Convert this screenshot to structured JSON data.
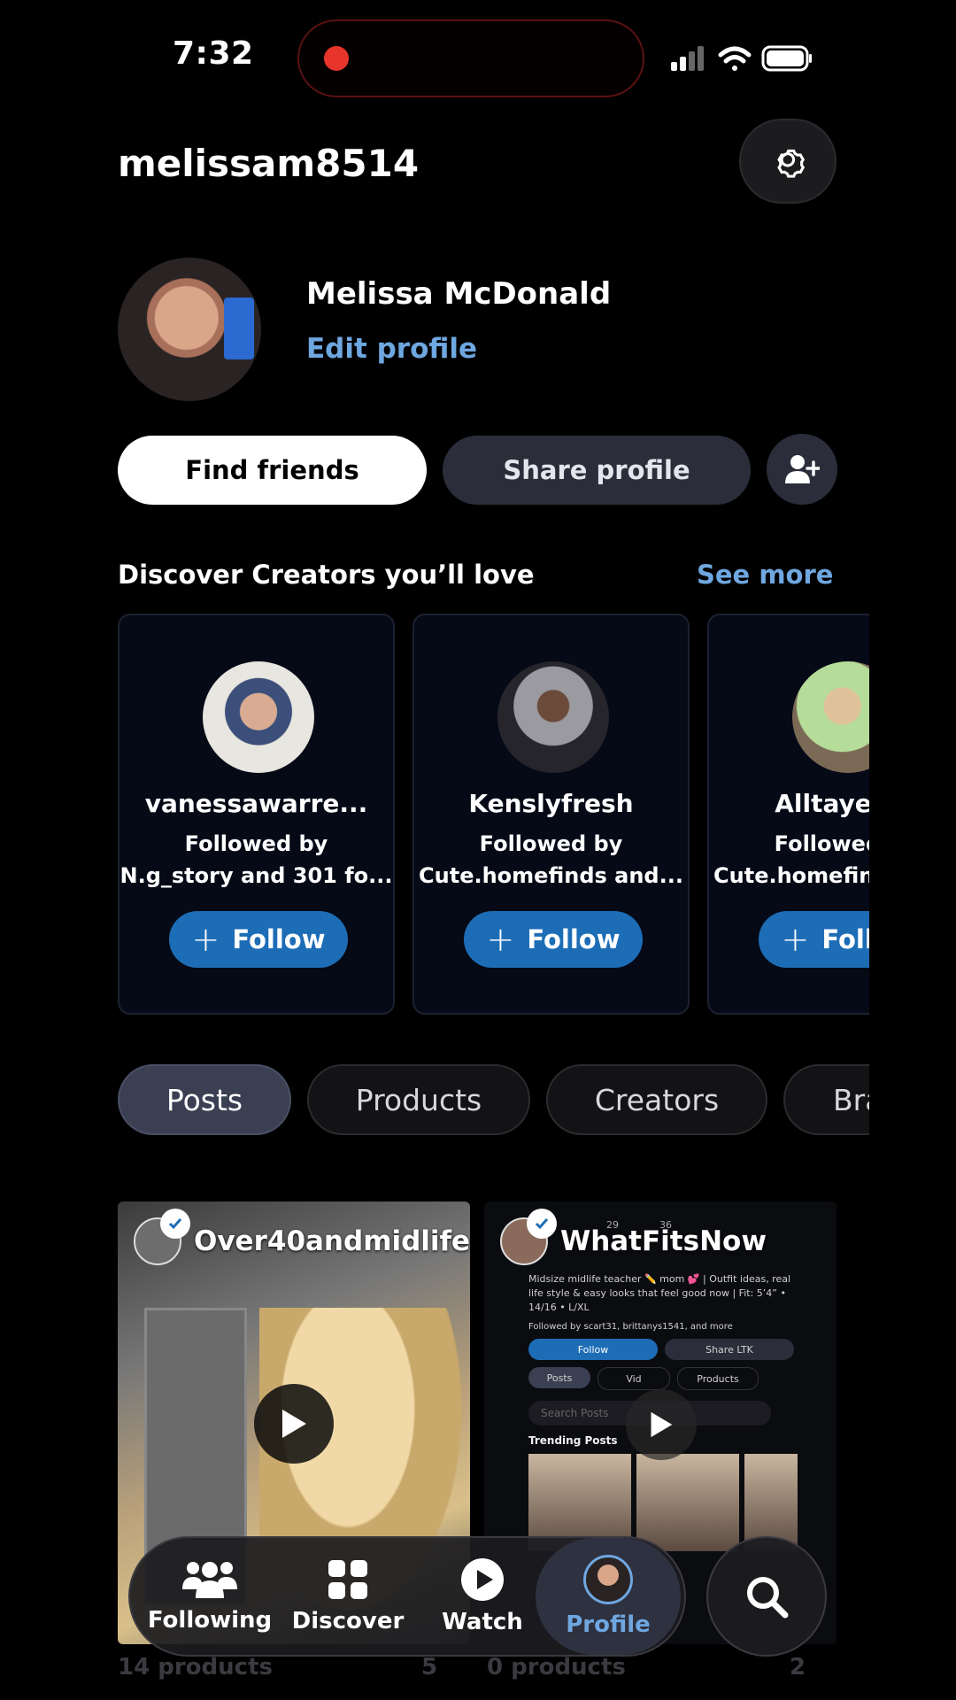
{
  "status_bar": {
    "time": "7:32"
  },
  "header": {
    "username": "melissam8514",
    "settings_icon": "gear-icon"
  },
  "profile": {
    "full_name": "Melissa McDonald",
    "edit_label": "Edit profile"
  },
  "actions": {
    "find_friends": "Find friends",
    "share_profile": "Share profile",
    "add_friend_icon": "add-person-icon"
  },
  "discover": {
    "title": "Discover Creators you’ll love",
    "see_more": "See more",
    "follow_label": "Follow",
    "creators": [
      {
        "name": "vanessawarre...",
        "followed_line1": "Followed by",
        "followed_line2": "N.g_story and 301 fo..."
      },
      {
        "name": "Kenslyfresh",
        "followed_line1": "Followed by",
        "followed_line2": "Cute.homefinds and..."
      },
      {
        "name": "Alltayever",
        "followed_line1": "Followed by",
        "followed_line2": "Cute.homefinds and..."
      }
    ]
  },
  "tabs": [
    "Posts",
    "Products",
    "Creators",
    "Brands"
  ],
  "posts": [
    {
      "creator": "Over40andmidlife",
      "footer_left": "14 products",
      "footer_right": "5"
    },
    {
      "creator": "WhatFitsNow",
      "footer_left": "0 products",
      "footer_right": "2",
      "preview": {
        "stat1": "29",
        "stat2": "36",
        "bio": "Midsize midlife teacher ✏️ mom 💕 | Outfit ideas, real life style & easy looks that feel good now | Fit: 5’4” • 14/16 • L/XL",
        "followed_by": "Followed by scart31, brittanys1541, and more",
        "follow": "Follow",
        "share": "Share LTK",
        "tab_posts": "Posts",
        "tab_videos": "Vid",
        "tab_products": "Products",
        "search_placeholder": "Search Posts",
        "trending": "Trending Posts"
      }
    }
  ],
  "nav": {
    "items": [
      "Following",
      "Discover",
      "Watch",
      "Profile"
    ],
    "active": "Profile"
  },
  "colors": {
    "accent": "#6fa7e0",
    "follow_blue": "#1d6db6",
    "record_dot": "#e8352b"
  }
}
